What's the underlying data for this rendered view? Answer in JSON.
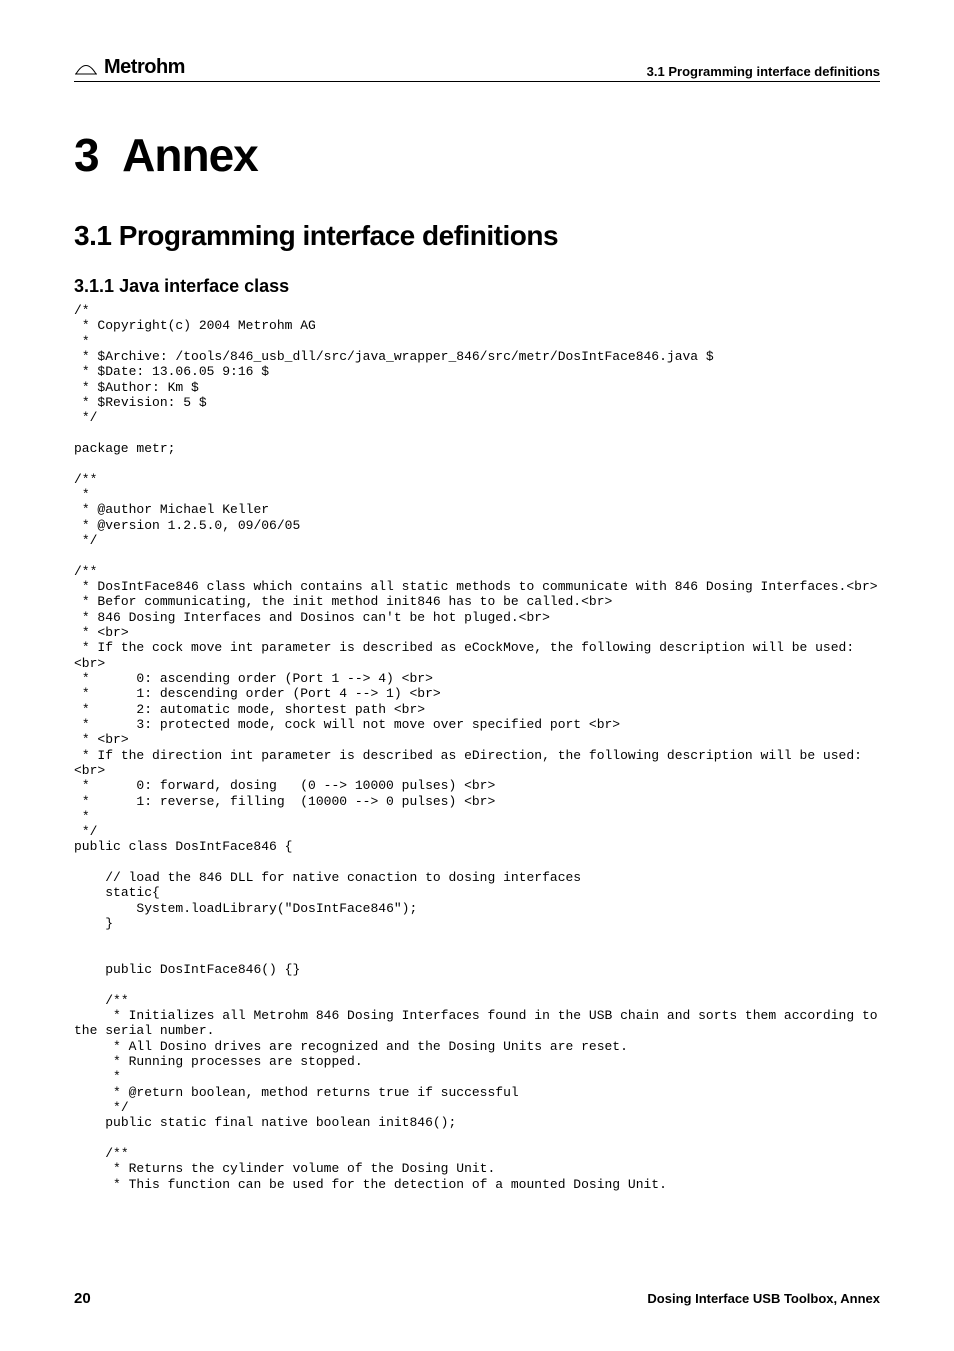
{
  "header": {
    "brand": "Metrohm",
    "right": "3.1 Programming interface definitions"
  },
  "chapter": {
    "num": "3",
    "title": "Annex"
  },
  "section": {
    "num": "3.1",
    "title": "Programming interface definitions"
  },
  "subsection": {
    "num": "3.1.1",
    "title": "Java interface class"
  },
  "code": "/*\n * Copyright(c) 2004 Metrohm AG\n *\n * $Archive: /tools/846_usb_dll/src/java_wrapper_846/src/metr/DosIntFace846.java $\n * $Date: 13.06.05 9:16 $\n * $Author: Km $\n * $Revision: 5 $\n */\n\npackage metr;\n\n/**\n *\n * @author Michael Keller\n * @version 1.2.5.0, 09/06/05\n */\n\n/**\n * DosIntFace846 class which contains all static methods to communicate with 846 Dosing Interfaces.<br>\n * Befor communicating, the init method init846 has to be called.<br>\n * 846 Dosing Interfaces and Dosinos can't be hot pluged.<br>\n * <br>\n * If the cock move int parameter is described as eCockMove, the following description will be used:<br>\n *      0: ascending order (Port 1 --> 4) <br>\n *      1: descending order (Port 4 --> 1) <br>\n *      2: automatic mode, shortest path <br>\n *      3: protected mode, cock will not move over specified port <br>\n * <br>\n * If the direction int parameter is described as eDirection, the following description will be used:<br>\n *      0: forward, dosing   (0 --> 10000 pulses) <br>\n *      1: reverse, filling  (10000 --> 0 pulses) <br>\n *\n */\npublic class DosIntFace846 {\n\n    // load the 846 DLL for native conaction to dosing interfaces\n    static{\n        System.loadLibrary(\"DosIntFace846\");\n    }\n\n\n    public DosIntFace846() {}\n\n    /**\n     * Initializes all Metrohm 846 Dosing Interfaces found in the USB chain and sorts them according to the serial number.\n     * All Dosino drives are recognized and the Dosing Units are reset.\n     * Running processes are stopped.\n     *\n     * @return boolean, method returns true if successful\n     */\n    public static final native boolean init846();\n\n    /**\n     * Returns the cylinder volume of the Dosing Unit.\n     * This function can be used for the detection of a mounted Dosing Unit.",
  "footer": {
    "page": "20",
    "right": "Dosing Interface USB Toolbox, Annex"
  }
}
